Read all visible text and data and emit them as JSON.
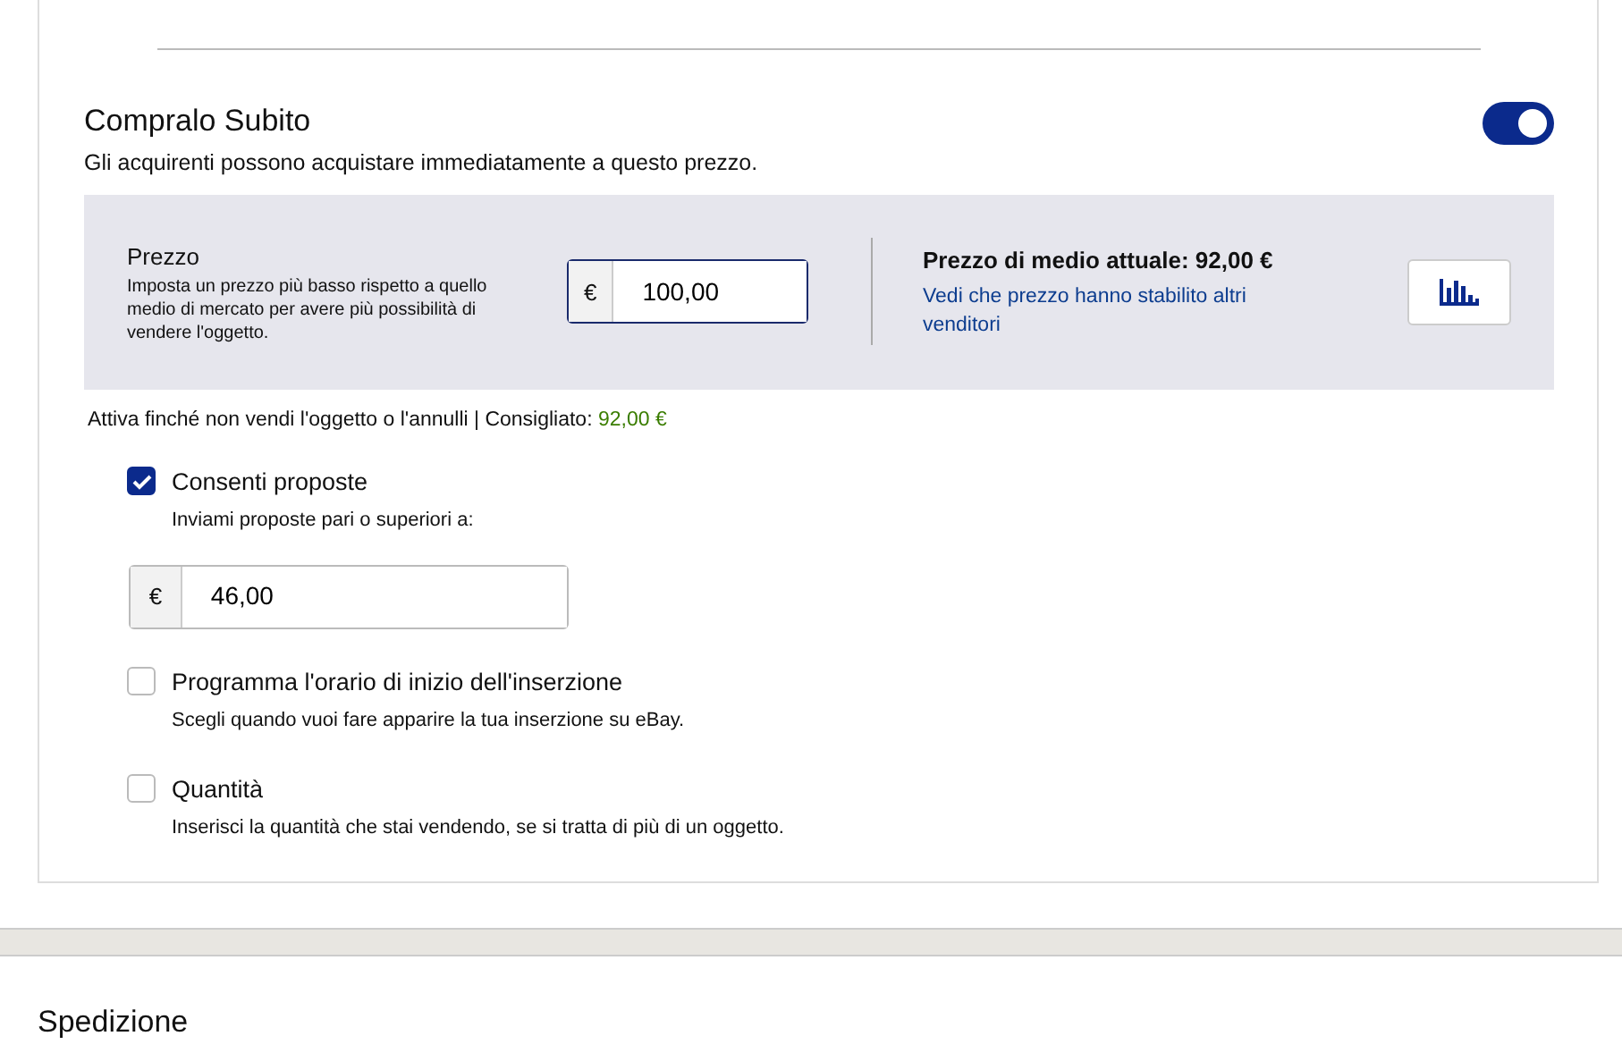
{
  "buy_now": {
    "title": "Compralo Subito",
    "on": true,
    "description": "Gli acquirenti possono acquistare immediatamente a questo prezzo.",
    "price": {
      "label": "Prezzo",
      "hint": "Imposta un prezzo più basso rispetto a quello medio di mercato per avere più possibilità di vendere l'oggetto.",
      "currency": "€",
      "value": "100,00"
    },
    "market": {
      "title": "Prezzo di medio attuale: 92,00 €",
      "link": "Vedi che prezzo hanno stabilito altri venditori"
    },
    "duration_note": "Attiva finché non vendi l'oggetto o l'annulli | Consigliato:",
    "recommended": "92,00 €"
  },
  "options": [
    {
      "label": "Consenti proposte",
      "hint": "Inviami proposte pari o superiori a:",
      "checked": true,
      "field": {
        "currency": "€",
        "value": "46,00"
      }
    },
    {
      "label": "Programma l'orario di inizio dell'inserzione",
      "hint": "Scegli quando vuoi fare apparire la tua inserzione su eBay.",
      "checked": false
    },
    {
      "label": "Quantità",
      "hint": "Inserisci la quantità che stai vendendo, se si tratta di più di un oggetto.",
      "checked": false
    }
  ],
  "next_section": {
    "title": "Spedizione"
  }
}
